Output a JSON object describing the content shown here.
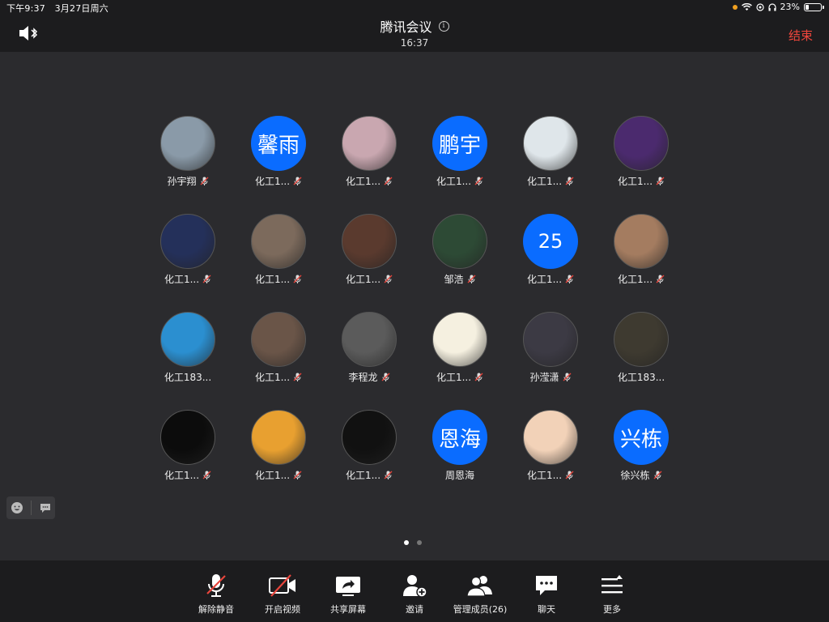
{
  "status_bar": {
    "time": "下午9:37",
    "date": "3月27日周六",
    "battery": "23%",
    "battery_level": 0.23
  },
  "header": {
    "title": "腾讯会议",
    "clock": "16:37",
    "end_label": "结束"
  },
  "participants": [
    {
      "name": "孙宇翔",
      "avatar": "photo",
      "color": "#8a9aa8",
      "muted": true
    },
    {
      "name": "化工1...",
      "avatar": "text",
      "text": "馨雨",
      "muted": true
    },
    {
      "name": "化工1...",
      "avatar": "photo",
      "color": "#c9a7b0",
      "muted": true
    },
    {
      "name": "化工1...",
      "avatar": "text",
      "text": "鹏宇",
      "muted": true
    },
    {
      "name": "化工1...",
      "avatar": "photo",
      "color": "#dfe6ea",
      "muted": true
    },
    {
      "name": "化工1...",
      "avatar": "photo",
      "color": "#4b2a6e",
      "muted": true
    },
    {
      "name": "化工1...",
      "avatar": "photo",
      "color": "#24305a",
      "muted": true
    },
    {
      "name": "化工1...",
      "avatar": "photo",
      "color": "#7c6a5c",
      "muted": true
    },
    {
      "name": "化工1...",
      "avatar": "photo",
      "color": "#5a3a2e",
      "muted": true
    },
    {
      "name": "邹浩",
      "avatar": "photo",
      "color": "#2d4a35",
      "muted": true
    },
    {
      "name": "化工1...",
      "avatar": "text",
      "text": "25",
      "muted": true
    },
    {
      "name": "化工1...",
      "avatar": "photo",
      "color": "#a47c60",
      "muted": true
    },
    {
      "name": "化工183...",
      "avatar": "photo",
      "color": "#2b8fd0",
      "muted": false
    },
    {
      "name": "化工1...",
      "avatar": "photo",
      "color": "#6a5548",
      "muted": true
    },
    {
      "name": "李程龙",
      "avatar": "photo",
      "color": "#5b5b5b",
      "muted": true
    },
    {
      "name": "化工1...",
      "avatar": "photo",
      "color": "#f5f0e0",
      "muted": true
    },
    {
      "name": "孙滢潇",
      "avatar": "photo",
      "color": "#3c3a44",
      "muted": true
    },
    {
      "name": "化工183...",
      "avatar": "photo",
      "color": "#3e3a30",
      "muted": false
    },
    {
      "name": "化工1...",
      "avatar": "photo",
      "color": "#0c0c0c",
      "muted": true
    },
    {
      "name": "化工1...",
      "avatar": "photo",
      "color": "#e8a030",
      "muted": true
    },
    {
      "name": "化工1...",
      "avatar": "photo",
      "color": "#111111",
      "muted": true
    },
    {
      "name": "周恩海",
      "avatar": "text",
      "text": "恩海",
      "muted": false
    },
    {
      "name": "化工1...",
      "avatar": "photo",
      "color": "#f2d2b8",
      "muted": true
    },
    {
      "name": "徐兴栋",
      "avatar": "text",
      "text": "兴栋",
      "muted": true
    }
  ],
  "toolbar": {
    "unmute": "解除静音",
    "video": "开启视频",
    "share": "共享屏幕",
    "invite": "邀请",
    "members": "管理成员(26)",
    "chat": "聊天",
    "more": "更多"
  },
  "colors": {
    "accent": "#0a6cff",
    "end": "#f0463c",
    "mute_red": "#e8453c"
  },
  "icons": [
    "speaker-bluetooth-icon",
    "info-icon",
    "mic-muted-icon",
    "video-off-icon",
    "share-screen-icon",
    "invite-icon",
    "members-icon",
    "chat-icon",
    "more-icon",
    "emoji-icon",
    "message-icon"
  ]
}
